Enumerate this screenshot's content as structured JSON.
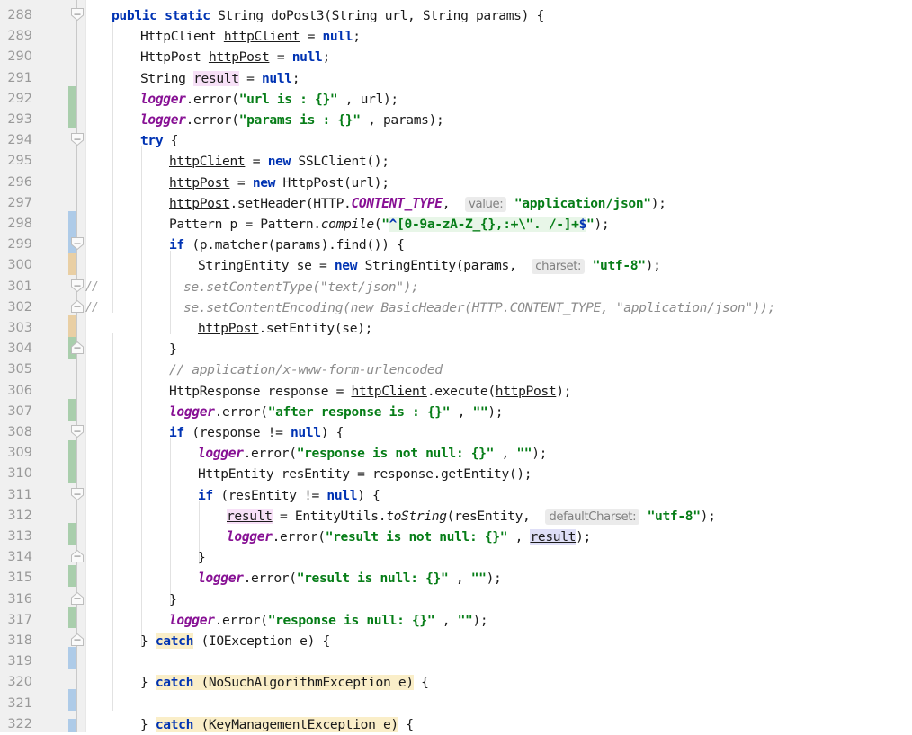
{
  "editor": {
    "language": "Java",
    "first_line": 288,
    "last_line": 322,
    "colors": {
      "gutter_bg": "#f0f0f0",
      "editor_bg": "#ffffff",
      "line_number": "#999999",
      "keyword": "#0033b3",
      "string": "#067d17",
      "comment": "#8c8c8c",
      "static_field": "#871094",
      "hint_bg": "#ebebeb",
      "hint_fg": "#808080",
      "regex_bg": "#e8f6e8",
      "warn_highlight": "#faeec8",
      "identifier_pink": "#f7e0f7",
      "identifier_lavender": "#dfdff7",
      "vcs_added": "#a9ceac",
      "vcs_modified": "#aecbe8",
      "vcs_changed": "#e9cfa4"
    }
  },
  "lines": [
    {
      "n": 288,
      "text": "public static String doPost3(String url, String params) {"
    },
    {
      "n": 289,
      "text": "    HttpClient httpClient = null;"
    },
    {
      "n": 290,
      "text": "    HttpPost httpPost = null;"
    },
    {
      "n": 291,
      "text": "    String result = null;"
    },
    {
      "n": 292,
      "text": "    logger.error(\"url is : {}\" , url);"
    },
    {
      "n": 293,
      "text": "    logger.error(\"params is : {}\" , params);"
    },
    {
      "n": 294,
      "text": "    try {"
    },
    {
      "n": 295,
      "text": "        httpClient = new SSLClient();"
    },
    {
      "n": 296,
      "text": "        httpPost = new HttpPost(url);"
    },
    {
      "n": 297,
      "text": "        httpPost.setHeader(HTTP.CONTENT_TYPE,  value: \"application/json\");"
    },
    {
      "n": 298,
      "text": "        Pattern p = Pattern.compile(\"^[0-9a-zA-Z_{},:+\\\". /-]+$\");"
    },
    {
      "n": 299,
      "text": "        if (p.matcher(params).find()) {"
    },
    {
      "n": 300,
      "text": "            StringEntity se = new StringEntity(params,  charset: \"utf-8\");"
    },
    {
      "n": 301,
      "text": "          se.setContentType(\"text/json\");"
    },
    {
      "n": 302,
      "text": "          se.setContentEncoding(new BasicHeader(HTTP.CONTENT_TYPE, \"application/json\"));"
    },
    {
      "n": 303,
      "text": "            httpPost.setEntity(se);"
    },
    {
      "n": 304,
      "text": "        }"
    },
    {
      "n": 305,
      "text": "        // application/x-www-form-urlencoded"
    },
    {
      "n": 306,
      "text": "        HttpResponse response = httpClient.execute(httpPost);"
    },
    {
      "n": 307,
      "text": "        logger.error(\"after response is : {}\" , \"\");"
    },
    {
      "n": 308,
      "text": "        if (response != null) {"
    },
    {
      "n": 309,
      "text": "            logger.error(\"response is not null: {}\" , \"\");"
    },
    {
      "n": 310,
      "text": "            HttpEntity resEntity = response.getEntity();"
    },
    {
      "n": 311,
      "text": "            if (resEntity != null) {"
    },
    {
      "n": 312,
      "text": "                result = EntityUtils.toString(resEntity,  defaultCharset: \"utf-8\");"
    },
    {
      "n": 313,
      "text": "                logger.error(\"result is not null: {}\" , result);"
    },
    {
      "n": 314,
      "text": "            }"
    },
    {
      "n": 315,
      "text": "            logger.error(\"result is null: {}\" , \"\");"
    },
    {
      "n": 316,
      "text": "        }"
    },
    {
      "n": 317,
      "text": "        logger.error(\"response is null: {}\" , \"\");"
    },
    {
      "n": 318,
      "text": "    } catch (IOException e) {"
    },
    {
      "n": 319,
      "text": ""
    },
    {
      "n": 320,
      "text": "    } catch (NoSuchAlgorithmException e) {"
    },
    {
      "n": 321,
      "text": ""
    },
    {
      "n": 322,
      "text": "    } catch (KeyManagementException e) {"
    }
  ],
  "gutter": {
    "comment_markers": [
      {
        "line": 301,
        "label": "//"
      },
      {
        "line": 302,
        "label": "//"
      }
    ],
    "fold_markers": [
      {
        "line": 288,
        "state": "expanded"
      },
      {
        "line": 294,
        "state": "expanded"
      },
      {
        "line": 299,
        "state": "expanded"
      },
      {
        "line": 301,
        "state": "expanded"
      },
      {
        "line": 302,
        "state": "collapsed-end"
      },
      {
        "line": 304,
        "state": "end"
      },
      {
        "line": 308,
        "state": "expanded"
      },
      {
        "line": 311,
        "state": "expanded"
      },
      {
        "line": 314,
        "state": "end"
      },
      {
        "line": 316,
        "state": "end"
      },
      {
        "line": 318,
        "state": "end"
      }
    ],
    "change_bars": [
      {
        "from": 292,
        "to": 293,
        "kind": "added"
      },
      {
        "from": 298,
        "to": 299,
        "kind": "modified"
      },
      {
        "from": 300,
        "to": 300,
        "kind": "changed"
      },
      {
        "from": 303,
        "to": 304,
        "kind": "changed"
      },
      {
        "from": 304,
        "to": 304,
        "kind": "added"
      },
      {
        "from": 307,
        "to": 307,
        "kind": "added"
      },
      {
        "from": 309,
        "to": 310,
        "kind": "added"
      },
      {
        "from": 313,
        "to": 313,
        "kind": "added"
      },
      {
        "from": 315,
        "to": 315,
        "kind": "added"
      },
      {
        "from": 317,
        "to": 318,
        "kind": "added"
      },
      {
        "from": 319,
        "to": 319,
        "kind": "modified"
      },
      {
        "from": 321,
        "to": 321,
        "kind": "modified"
      },
      {
        "from": 322,
        "to": 322,
        "kind": "modified"
      }
    ]
  },
  "inlay_hints": [
    {
      "line": 297,
      "label": "value:"
    },
    {
      "line": 300,
      "label": "charset:"
    },
    {
      "line": 312,
      "label": "defaultCharset:"
    }
  ],
  "highlights": {
    "warning_catch": [
      "catch",
      "catch (NoSuchAlgorithmException e)",
      "catch (KeyManagementException e)"
    ],
    "identifier_occurrence": [
      "result"
    ]
  }
}
